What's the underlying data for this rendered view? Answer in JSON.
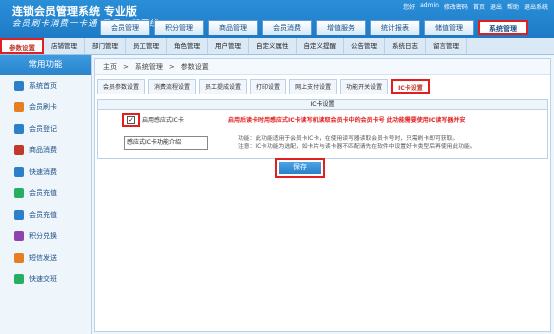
{
  "header": {
    "brand": "连锁会员管理系统 专业版",
    "slogan": "会员刷卡消费一卡通 只需一部网线",
    "top_links": [
      "您好",
      "admin",
      "修改密码",
      "首页",
      "退出",
      "帮助",
      "退出系统"
    ]
  },
  "main_tabs": [
    "会员管理",
    "积分管理",
    "商品管理",
    "会员消费",
    "增值服务",
    "统计报表",
    "储值管理",
    "系统管理"
  ],
  "sub_nav": [
    "参数设置",
    "店铺管理",
    "部门管理",
    "员工管理",
    "角色管理",
    "用户管理",
    "自定义属性",
    "自定义提醒",
    "公告管理",
    "系统日志",
    "留言管理"
  ],
  "sidebar": {
    "title": "常用功能",
    "items": [
      "系统首页",
      "会员刷卡",
      "会员登记",
      "商品消费",
      "快速消费",
      "会员充值",
      "会员充值",
      "积分兑换",
      "短信发送",
      "快速交班"
    ],
    "icon_colors": [
      "#2b80c8",
      "#e67e22",
      "#2b80c8",
      "#c0392b",
      "#2b80c8",
      "#27ae60",
      "#2b80c8",
      "#8e44ad",
      "#e67e22",
      "#27ae60"
    ]
  },
  "breadcrumb": [
    "主页",
    ">",
    "系统管理",
    ">",
    "参数设置"
  ],
  "tabs": [
    "会员参数设置",
    "消费流程设置",
    "员工提成设置",
    "打印设置",
    "网上支付设置",
    "功能开关设置",
    "IC卡设置"
  ],
  "panel": {
    "title": "IC卡设置",
    "checkbox_label": "启用感应式IC卡",
    "checkbox_mark": "✓",
    "warning": "启用后读卡时用感应式IC卡读写机读取会员卡中的会员卡号 此功能需要使用IC读写器并安",
    "select_value": "感应式IC卡功能介绍",
    "note_line1": "功能：此功能适用于会员卡IC卡，在使用读写器读取会员卡号时，只需刷卡即可获取。",
    "note_line2": "注意：IC卡功能为选配，如卡片与读卡器不匹配请先在软件中设置好卡类型后再使用此功能。"
  },
  "save_label": "保存"
}
